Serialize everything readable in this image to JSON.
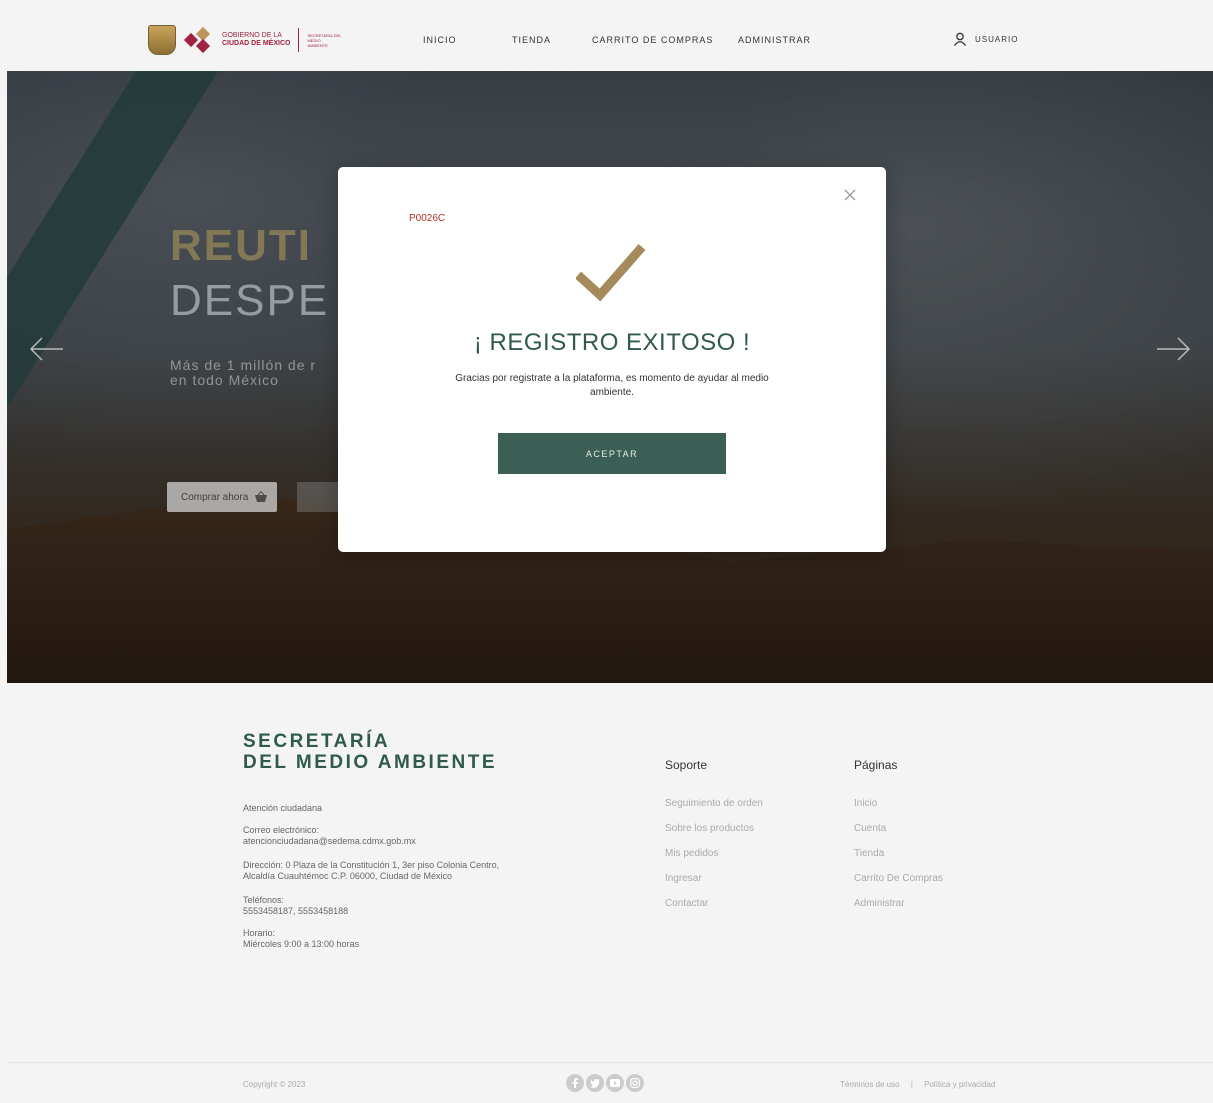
{
  "header": {
    "gov_line1": "GOBIERNO DE LA",
    "gov_line2": "CIUDAD DE MÉXICO",
    "sec_text": "SECRETARÍA DEL MEDIO AMBIENTE",
    "nav": [
      "INICIO",
      "TIENDA",
      "CARRITO DE COMPRAS",
      "ADMINISTRAR"
    ],
    "user_label": "USUARIO",
    "brand_color": "#9f2241"
  },
  "hero": {
    "title1": "REUTI",
    "title2": "DESPE",
    "subtitle_line1": "Más de 1 millón de r",
    "subtitle_line2": "en todo México",
    "buy_label": "Comprar ahora"
  },
  "modal": {
    "code": "P0026C",
    "title": "¡ REGISTRO EXITOSO !",
    "message": "Gracias por registrate a la plataforma, es momento de ayudar al medio ambiente.",
    "accept_label": "ACEPTAR",
    "check_color": "#a58a5c",
    "button_color": "#3b5f55"
  },
  "footer": {
    "title_line1": "SECRETARÍA",
    "title_line2": "DEL MEDIO AMBIENTE",
    "attention": "Atención ciudadana",
    "email_label": "Correo electrónico:",
    "email": "atencionciudadana@sedema.cdmx.gob.mx",
    "address_line1": "Dirección: 0 Plaza de la Constitución 1, 3er piso Colonia Centro,",
    "address_line2": "Alcaldía Cuauhtémoc C.P. 06000, Ciudad de México",
    "phones_label": "Teléfonos:",
    "phones": "5553458187, 5553458188",
    "schedule_label": "Horario:",
    "schedule": "Miércoles 9:00 a 13:00 horas",
    "support_head": "Soporte",
    "support_links": [
      "Seguimiento de orden",
      "Sobre los productos",
      "Mis pedidos",
      "Ingresar",
      "Contactar"
    ],
    "pages_head": "Páginas",
    "pages_links": [
      "Inicio",
      "Cuenta",
      "Tienda",
      "Carrito De Compras",
      "Administrar"
    ],
    "copyright": "Copyright © 2023",
    "terms": "Términos de uso",
    "separator": "|",
    "privacy": "Política y privacidad",
    "socials": [
      "facebook-icon",
      "twitter-icon",
      "youtube-icon",
      "instagram-icon"
    ]
  }
}
